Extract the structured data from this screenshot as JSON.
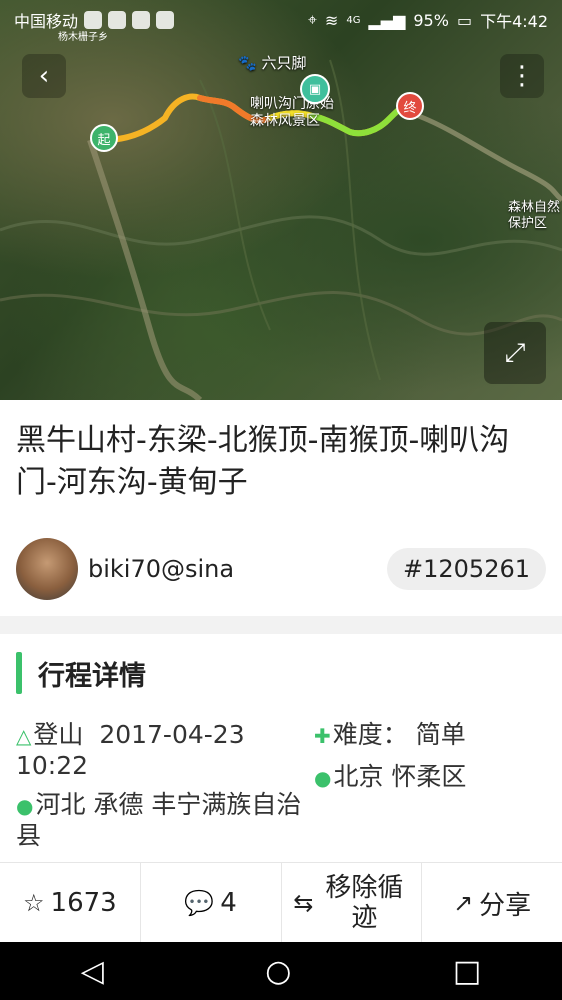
{
  "status_bar": {
    "carrier": "中国移动",
    "battery": "95%",
    "network": "4G",
    "time": "下午4:42"
  },
  "map": {
    "village_label": "杨木栅子乡",
    "poi_brand": "六只脚",
    "poi_scenic": "喇叭沟门原始\n森林风景区",
    "poi_reserve": "森林自然\n保护区",
    "start_marker": "起",
    "end_marker": "终",
    "route_colors": [
      "#f5b324",
      "#f07a2a",
      "#f4e02a",
      "#8ee03a",
      "#5fd23a"
    ]
  },
  "trip": {
    "title": "黑牛山村-东梁-北猴顶-南猴顶-喇叭沟门-河东沟-黄甸子",
    "author": "biki70@sina",
    "id": "#1205261"
  },
  "details": {
    "section_title": "行程详情",
    "activity": "登山",
    "date": "2017-04-23",
    "time": "10:22",
    "difficulty_label": "难度：",
    "difficulty": "简单",
    "start_location": "河北  承德  丰宁满族自治县",
    "end_location": "北京  怀柔区"
  },
  "actions": {
    "favorites": "1673",
    "comments": "4",
    "remove_track": "移除循迹",
    "share": "分享"
  },
  "accent_color": "#3bc16b"
}
